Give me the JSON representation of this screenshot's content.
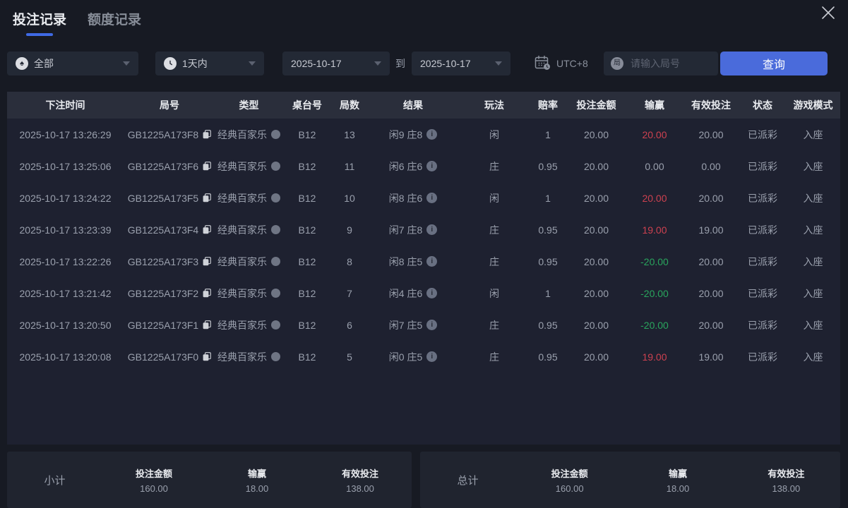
{
  "tabs": [
    {
      "label": "投注记录",
      "active": true
    },
    {
      "label": "额度记录",
      "active": false
    }
  ],
  "filters": {
    "game_type_value": "全部",
    "time_range_value": "1天内",
    "date_from": "2025-10-17",
    "date_to_label": "到",
    "date_to": "2025-10-17",
    "timezone": "UTC+8",
    "round_input_placeholder": "请输入局号",
    "search_button_label": "查询"
  },
  "icons": {
    "spade": "♠",
    "round_char": "局",
    "info": "i"
  },
  "table": {
    "headers": [
      "下注时间",
      "局号",
      "类型",
      "桌台号",
      "局数",
      "结果",
      "玩法",
      "赔率",
      "投注金额",
      "输赢",
      "有效投注",
      "状态",
      "游戏模式"
    ],
    "rows": [
      {
        "time": "2025-10-17 13:26:29",
        "round_id": "GB1225A173F8",
        "type": "经典百家乐",
        "table": "B12",
        "games": "13",
        "result": "闲9 庄8",
        "play": "闲",
        "odds": "1",
        "bet": "20.00",
        "winloss": "20.00",
        "winloss_color": "red",
        "valid": "20.00",
        "status": "已派彩",
        "mode": "入座"
      },
      {
        "time": "2025-10-17 13:25:06",
        "round_id": "GB1225A173F6",
        "type": "经典百家乐",
        "table": "B12",
        "games": "11",
        "result": "闲6 庄6",
        "play": "庄",
        "odds": "0.95",
        "bet": "20.00",
        "winloss": "0.00",
        "winloss_color": "neutral",
        "valid": "0.00",
        "status": "已派彩",
        "mode": "入座"
      },
      {
        "time": "2025-10-17 13:24:22",
        "round_id": "GB1225A173F5",
        "type": "经典百家乐",
        "table": "B12",
        "games": "10",
        "result": "闲8 庄6",
        "play": "闲",
        "odds": "1",
        "bet": "20.00",
        "winloss": "20.00",
        "winloss_color": "red",
        "valid": "20.00",
        "status": "已派彩",
        "mode": "入座"
      },
      {
        "time": "2025-10-17 13:23:39",
        "round_id": "GB1225A173F4",
        "type": "经典百家乐",
        "table": "B12",
        "games": "9",
        "result": "闲7 庄8",
        "play": "庄",
        "odds": "0.95",
        "bet": "20.00",
        "winloss": "19.00",
        "winloss_color": "red",
        "valid": "19.00",
        "status": "已派彩",
        "mode": "入座"
      },
      {
        "time": "2025-10-17 13:22:26",
        "round_id": "GB1225A173F3",
        "type": "经典百家乐",
        "table": "B12",
        "games": "8",
        "result": "闲8 庄5",
        "play": "庄",
        "odds": "0.95",
        "bet": "20.00",
        "winloss": "-20.00",
        "winloss_color": "green",
        "valid": "20.00",
        "status": "已派彩",
        "mode": "入座"
      },
      {
        "time": "2025-10-17 13:21:42",
        "round_id": "GB1225A173F2",
        "type": "经典百家乐",
        "table": "B12",
        "games": "7",
        "result": "闲4 庄6",
        "play": "闲",
        "odds": "1",
        "bet": "20.00",
        "winloss": "-20.00",
        "winloss_color": "green",
        "valid": "20.00",
        "status": "已派彩",
        "mode": "入座"
      },
      {
        "time": "2025-10-17 13:20:50",
        "round_id": "GB1225A173F1",
        "type": "经典百家乐",
        "table": "B12",
        "games": "6",
        "result": "闲7 庄5",
        "play": "庄",
        "odds": "0.95",
        "bet": "20.00",
        "winloss": "-20.00",
        "winloss_color": "green",
        "valid": "20.00",
        "status": "已派彩",
        "mode": "入座"
      },
      {
        "time": "2025-10-17 13:20:08",
        "round_id": "GB1225A173F0",
        "type": "经典百家乐",
        "table": "B12",
        "games": "5",
        "result": "闲0 庄5",
        "play": "庄",
        "odds": "0.95",
        "bet": "20.00",
        "winloss": "19.00",
        "winloss_color": "red",
        "valid": "19.00",
        "status": "已派彩",
        "mode": "入座"
      }
    ]
  },
  "summary": {
    "subtotal": {
      "label": "小计",
      "items": [
        {
          "label": "投注金额",
          "value": "160.00"
        },
        {
          "label": "输赢",
          "value": "18.00",
          "color": "red"
        },
        {
          "label": "有效投注",
          "value": "138.00"
        }
      ]
    },
    "total": {
      "label": "总计",
      "items": [
        {
          "label": "投注金额",
          "value": "160.00"
        },
        {
          "label": "输赢",
          "value": "18.00",
          "color": "red"
        },
        {
          "label": "有效投注",
          "value": "138.00"
        }
      ]
    }
  },
  "colors": {
    "accent_blue": "#4a6bdb",
    "win_red": "#cd4150",
    "loss_green": "#29a55d"
  }
}
